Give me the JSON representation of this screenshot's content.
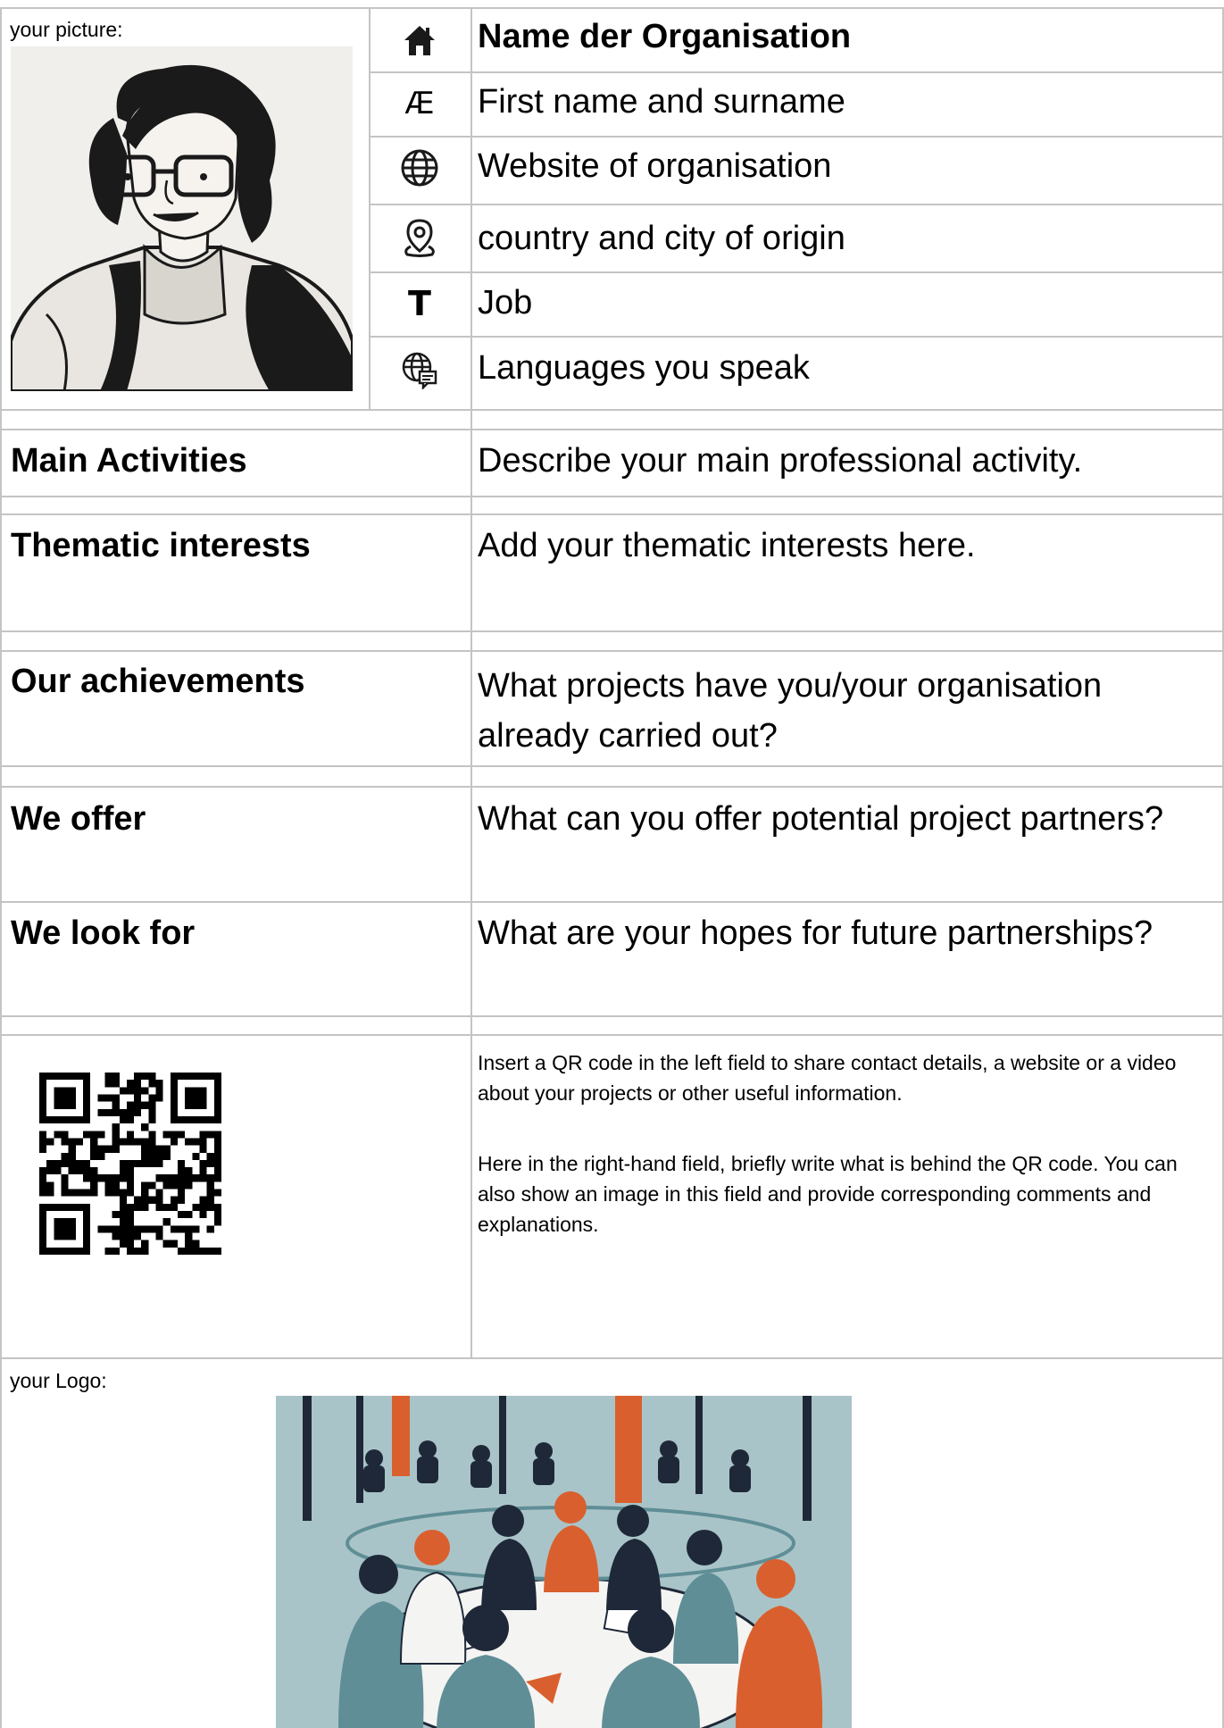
{
  "header": {
    "picture_label": "your picture:",
    "org_name": "Name der Organisation",
    "full_name": "First name and surname",
    "website": "Website of organisation",
    "origin": "country and city of origin",
    "job": "Job",
    "languages": "Languages you speak",
    "icons": [
      "house-icon",
      "ae-letter-icon",
      "globe-icon",
      "location-pin-icon",
      "text-t-icon",
      "globe-chat-icon"
    ],
    "name_glyph": "Æ",
    "job_glyph": "T"
  },
  "sections": [
    {
      "label": "Main Activities",
      "text": "Describe your main professional activity."
    },
    {
      "label": "Thematic interests",
      "text": "Add your thematic interests here."
    },
    {
      "label": "Our achievements",
      "text": "What projects have you/your organisation already carried out?"
    },
    {
      "label": "We offer",
      "text": "What can you offer potential project partners?"
    },
    {
      "label": "We look for",
      "text": "What are your hopes for future partnerships?"
    }
  ],
  "qr": {
    "paragraph1": "Insert a QR code in the left field to share contact details, a website or a video about your projects or other useful information.",
    "paragraph2": "Here in the right-hand field, briefly write what is behind the QR code. You can also show an image in this field and provide corresponding comments and explanations."
  },
  "logo": {
    "label": "your Logo:"
  },
  "colors": {
    "border": "#c4c4c4",
    "illustration_teal": "#5f8e96",
    "illustration_orange": "#d9602e",
    "illustration_navy": "#1e2838"
  }
}
